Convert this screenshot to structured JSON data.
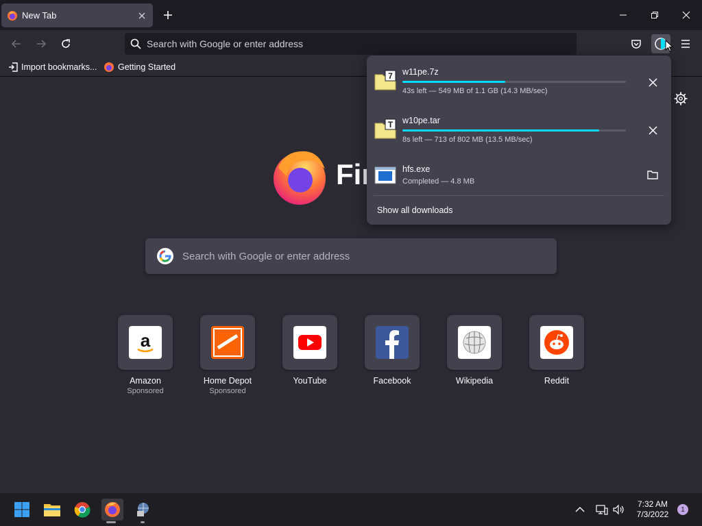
{
  "tab": {
    "title": "New Tab"
  },
  "navbar": {
    "url_placeholder": "Search with Google or enter address"
  },
  "bookmarks": [
    {
      "label": "Import bookmarks..."
    },
    {
      "label": "Getting Started"
    }
  ],
  "newtab": {
    "brand_word": "Fir",
    "search_placeholder": "Search with Google or enter address",
    "top_sites": [
      {
        "label": "Amazon",
        "sub": "Sponsored"
      },
      {
        "label": "Home Depot",
        "sub": "Sponsored"
      },
      {
        "label": "YouTube",
        "sub": ""
      },
      {
        "label": "Facebook",
        "sub": ""
      },
      {
        "label": "Wikipedia",
        "sub": ""
      },
      {
        "label": "Reddit",
        "sub": ""
      }
    ]
  },
  "downloads": {
    "items": [
      {
        "name": "w11pe.7z",
        "status": "43s left — 549 MB of 1.1 GB (14.3 MB/sec)",
        "progress": 0.46,
        "icon_letter": "7"
      },
      {
        "name": "w10pe.tar",
        "status": "8s left — 713 of 802 MB (13.5 MB/sec)",
        "progress": 0.88,
        "icon_letter": "T"
      },
      {
        "name": "hfs.exe",
        "status": "Completed — 4.8 MB",
        "progress": 1.0,
        "icon_letter": ""
      }
    ],
    "show_all": "Show all downloads"
  },
  "taskbar": {
    "time": "7:32 AM",
    "date": "7/3/2022",
    "notifications": "1"
  },
  "colors": {
    "accent": "#00ddff",
    "panel": "#42414d",
    "background": "#2b2a33"
  }
}
